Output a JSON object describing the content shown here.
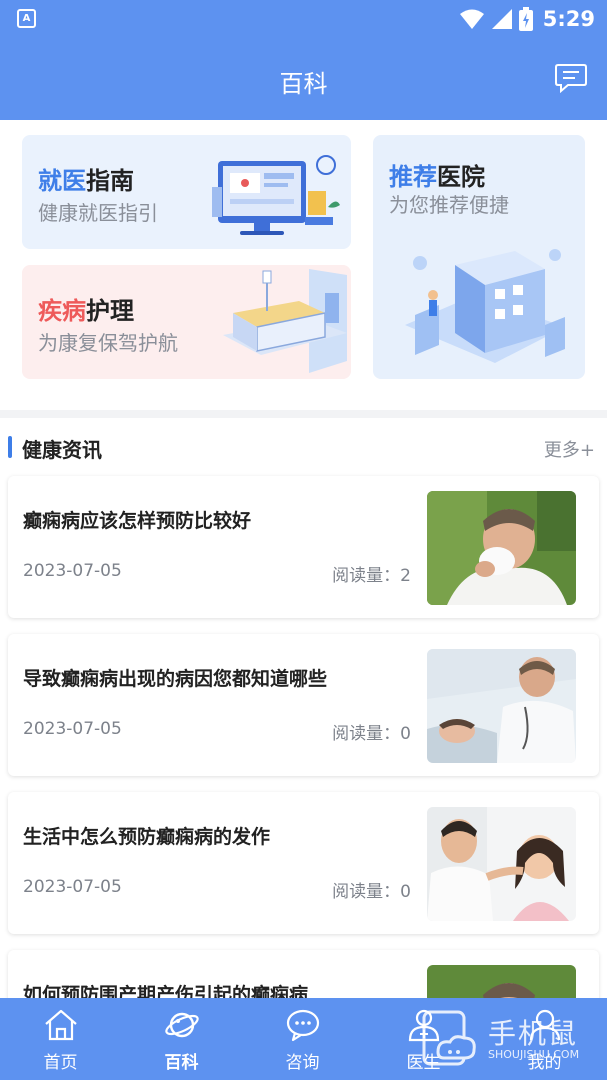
{
  "status_bar": {
    "time": "5:29",
    "app_badge": "A"
  },
  "header": {
    "title": "百科",
    "right_icon": "message-icon"
  },
  "cards": {
    "guide": {
      "title_highlight": "就医",
      "title_rest": "指南",
      "subtitle": "健康就医指引"
    },
    "care": {
      "title_highlight": "疾病",
      "title_rest": "护理",
      "subtitle": "为康复保驾护航"
    },
    "hospital": {
      "title_highlight": "推荐",
      "title_rest": "医院",
      "subtitle": "为您推荐便捷"
    }
  },
  "news": {
    "title": "健康资讯",
    "more": "更多+",
    "articles": [
      {
        "title": "癫痫病应该怎样预防比较好",
        "date": "2023-07-05",
        "reads": "阅读量：2"
      },
      {
        "title": "导致癫痫病出现的病因您都知道哪些",
        "date": "2023-07-05",
        "reads": "阅读量：0"
      },
      {
        "title": "生活中怎么预防癫痫病的发作",
        "date": "2023-07-05",
        "reads": "阅读量：0"
      },
      {
        "title": "如何预防围产期产伤引起的癫痫病",
        "date": "",
        "reads": ""
      }
    ]
  },
  "tabs": [
    {
      "label": "首页",
      "icon": "home-icon",
      "active": false
    },
    {
      "label": "百科",
      "icon": "planet-icon",
      "active": true
    },
    {
      "label": "咨询",
      "icon": "chat-icon",
      "active": false
    },
    {
      "label": "医生",
      "icon": "doctor-icon",
      "active": false
    },
    {
      "label": "我的",
      "icon": "user-icon",
      "active": false
    }
  ],
  "watermark": {
    "cn": "手机鼠",
    "en": "SHOUJISHU.COM"
  },
  "colors": {
    "primary": "#5d92f0",
    "accent_blue": "#3e7ee8",
    "accent_red": "#ee5a5a"
  }
}
